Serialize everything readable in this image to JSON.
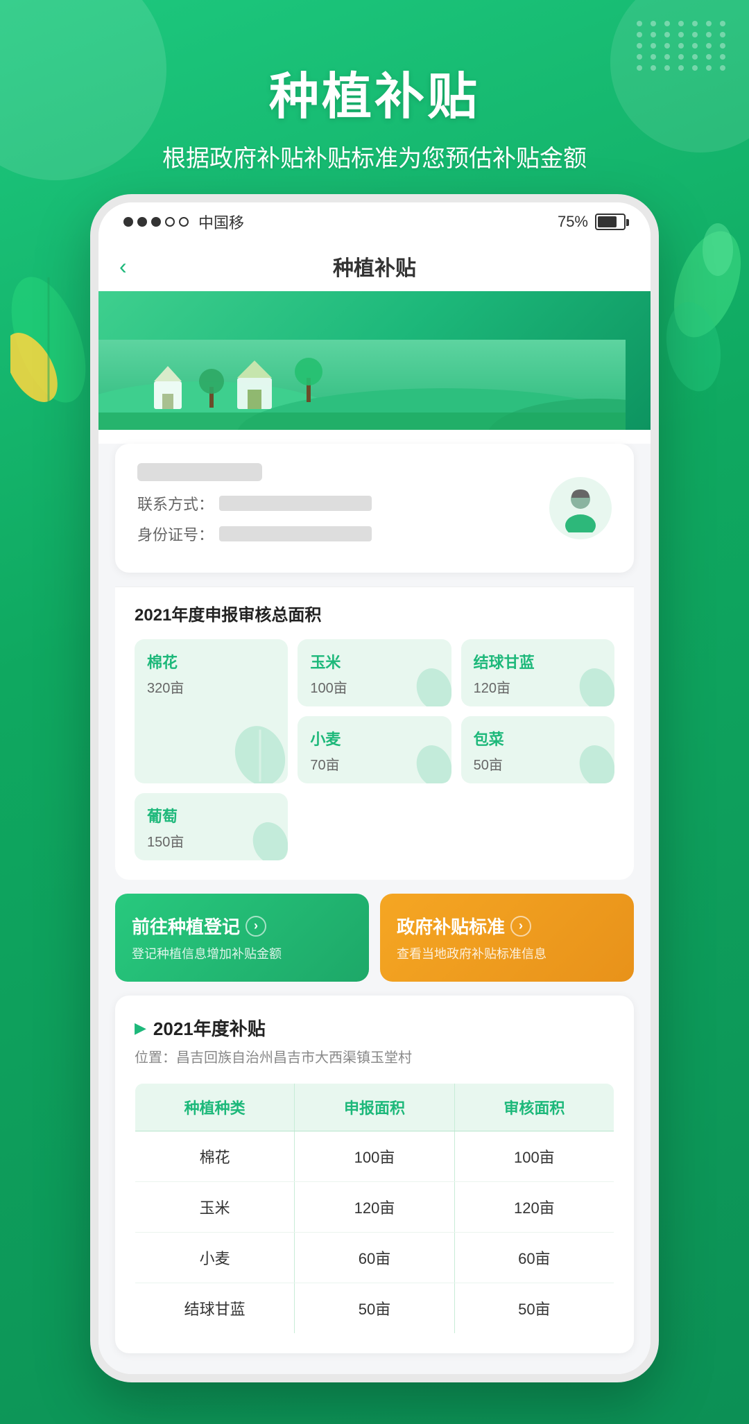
{
  "background": {
    "color": "#1db87a"
  },
  "header": {
    "main_title": "种植补贴",
    "sub_title": "根据政府补贴补贴标准为您预估补贴金额"
  },
  "status_bar": {
    "signal_text": "中国移",
    "battery_pct": "75%"
  },
  "app_navbar": {
    "back_label": "‹",
    "title": "种植补贴"
  },
  "user_card": {
    "contact_label": "联系方式：",
    "id_label": "身份证号："
  },
  "stats": {
    "section_title": "2021年度申报审核总面积",
    "crops": [
      {
        "name": "棉花",
        "area": "320亩"
      },
      {
        "name": "玉米",
        "area": "100亩"
      },
      {
        "name": "结球甘蓝",
        "area": "120亩"
      },
      {
        "name": "小麦",
        "area": "70亩"
      },
      {
        "name": "包菜",
        "area": "50亩"
      },
      {
        "name": "葡萄",
        "area": "150亩"
      }
    ]
  },
  "action_buttons": [
    {
      "title": "前往种植登记",
      "sub": "登记种植信息增加补贴金额",
      "type": "green"
    },
    {
      "title": "政府补贴标准",
      "sub": "查看当地政府补贴标准信息",
      "type": "orange"
    }
  ],
  "subsidy_section": {
    "section_title": "2021年度补贴",
    "location_label": "位置：昌吉回族自治州昌吉市大西渠镇玉堂村",
    "table": {
      "headers": [
        "种植种类",
        "申报面积",
        "审核面积"
      ],
      "rows": [
        [
          "棉花",
          "100亩",
          "100亩"
        ],
        [
          "玉米",
          "120亩",
          "120亩"
        ],
        [
          "小麦",
          "60亩",
          "60亩"
        ],
        [
          "结球甘蓝",
          "50亩",
          "50亩"
        ]
      ]
    }
  },
  "icons": {
    "leaf": "🌿",
    "wheat": "🌾",
    "arrow_right": "›",
    "back": "‹",
    "triangle": "▶"
  }
}
